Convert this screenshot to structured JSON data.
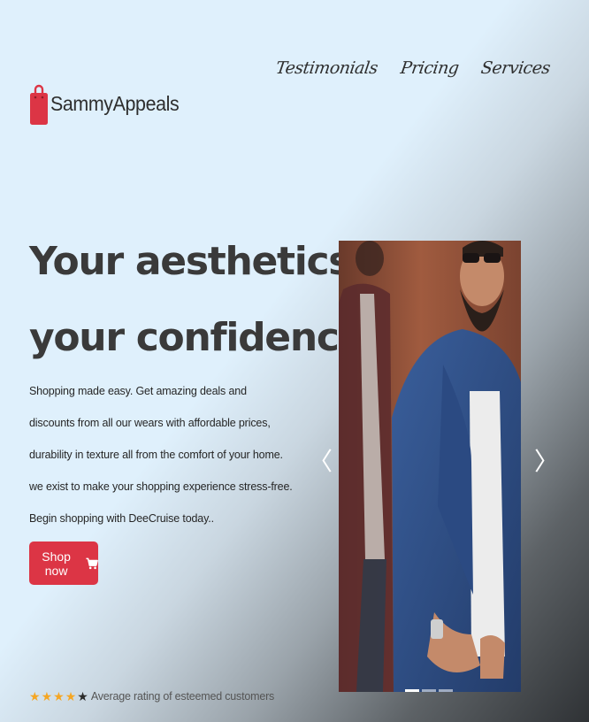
{
  "nav": {
    "items": [
      {
        "label": "Testimonials"
      },
      {
        "label": "Pricing"
      },
      {
        "label": "Services"
      }
    ]
  },
  "brand": {
    "name": "SammyAppeals",
    "icon": "shopping-bag-icon",
    "color": "#dc3545"
  },
  "hero": {
    "title_line1": "Your aesthetics is",
    "title_line2": "your confidence...",
    "description": "Shopping made easy. Get amazing deals and discounts from all our wears with affordable prices, durability in texture all from the comfort of your home. we exist to make your shopping experience stress-free. Begin shopping with DeeCruise today..",
    "cta_label": "Shop now",
    "cta_icon": "cart-icon",
    "cta_color": "#dc3545"
  },
  "carousel": {
    "prev_icon": "chevron-left-icon",
    "next_icon": "chevron-right-icon",
    "prev_glyph": "〈",
    "next_glyph": "〉",
    "slide_count": 3,
    "active_slide": 0
  },
  "rating": {
    "filled_stars": 4,
    "total_stars": 5,
    "star_color": "#f5a623",
    "empty_star_color": "#2b2b2b",
    "text": "Average rating of esteemed customers"
  }
}
